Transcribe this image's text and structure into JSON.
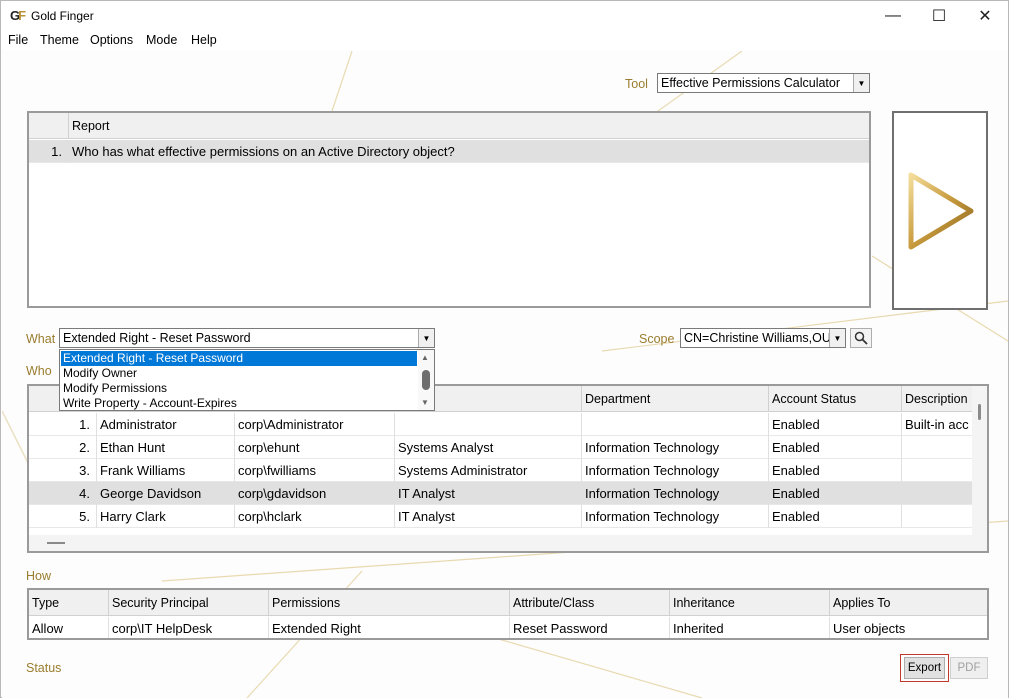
{
  "window": {
    "title": "Gold Finger",
    "logo_text_g": "G",
    "logo_text_f": "F",
    "minimize_glyph": "—",
    "maximize_glyph": "☐",
    "close_glyph": "✕"
  },
  "menu": [
    "File",
    "Theme",
    "Options",
    "Mode",
    "Help"
  ],
  "tool": {
    "label": "Tool",
    "value": "Effective Permissions Calculator"
  },
  "report_table": {
    "header": "Report",
    "rows": [
      {
        "num": "1.",
        "text": "Who has what effective permissions on an Active Directory object?"
      }
    ]
  },
  "what": {
    "label": "What",
    "value": "Extended Right - Reset Password",
    "options": [
      "Extended Right - Reset Password",
      "Modify Owner",
      "Modify Permissions",
      "Write Property - Account-Expires"
    ]
  },
  "scope": {
    "label": "Scope",
    "value": "CN=Christine Williams,OU"
  },
  "who": {
    "label": "Who",
    "columns": [
      "",
      "",
      "",
      "",
      "Department",
      "Account Status",
      "Description"
    ],
    "rows": [
      {
        "num": "1.",
        "name": "Administrator",
        "account": "corp\\Administrator",
        "title": "",
        "department": "",
        "status": "Enabled",
        "description": "Built-in acc"
      },
      {
        "num": "2.",
        "name": "Ethan Hunt",
        "account": "corp\\ehunt",
        "title": "Systems Analyst",
        "department": "Information Technology",
        "status": "Enabled",
        "description": ""
      },
      {
        "num": "3.",
        "name": "Frank Williams",
        "account": "corp\\fwilliams",
        "title": "Systems Administrator",
        "department": "Information Technology",
        "status": "Enabled",
        "description": ""
      },
      {
        "num": "4.",
        "name": "George Davidson",
        "account": "corp\\gdavidson",
        "title": "IT Analyst",
        "department": "Information Technology",
        "status": "Enabled",
        "description": ""
      },
      {
        "num": "5.",
        "name": "Harry Clark",
        "account": "corp\\hclark",
        "title": "IT Analyst",
        "department": "Information Technology",
        "status": "Enabled",
        "description": ""
      }
    ]
  },
  "how": {
    "label": "How",
    "columns": [
      "Type",
      "Security Principal",
      "Permissions",
      "Attribute/Class",
      "Inheritance",
      "Applies To"
    ],
    "rows": [
      {
        "type": "Allow",
        "principal": "corp\\IT HelpDesk",
        "permissions": "Extended Right",
        "attribute": "Reset Password",
        "inheritance": "Inherited",
        "applies_to": "User objects"
      }
    ]
  },
  "status": {
    "label": "Status"
  },
  "buttons": {
    "export": "Export",
    "pdf": "PDF"
  },
  "icons": {
    "run": "play-triangle-icon",
    "search": "magnifier-icon"
  },
  "colors": {
    "accent_gold": "#9a7d2e",
    "selection_blue": "#0078d7",
    "export_highlight": "#c0392b"
  }
}
